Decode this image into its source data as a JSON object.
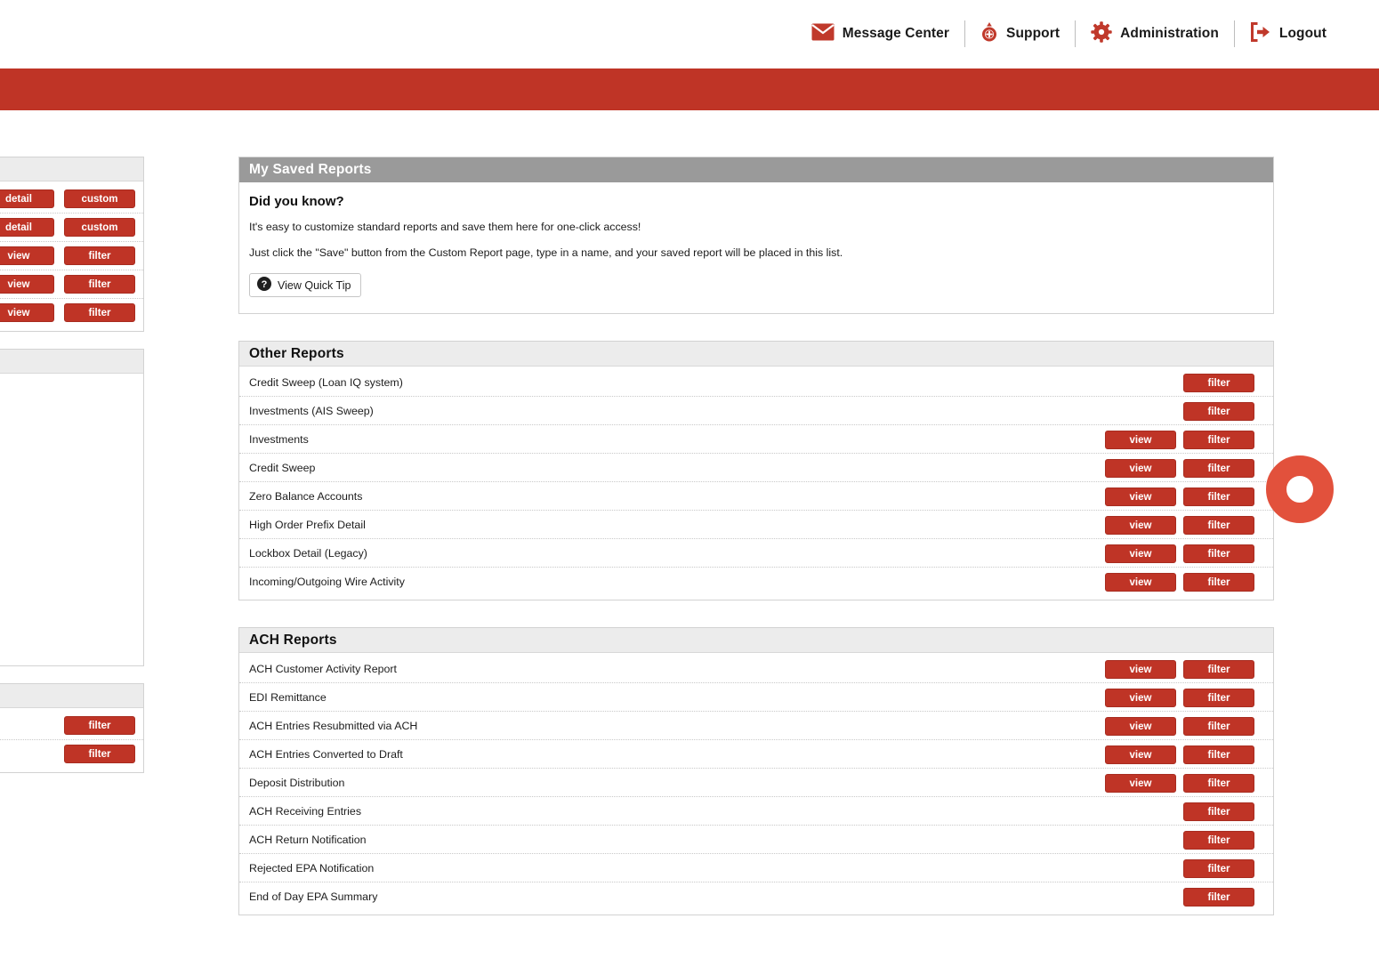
{
  "topbar": {
    "items": [
      {
        "label": "Message Center",
        "icon": "envelope-icon"
      },
      {
        "label": "Support",
        "icon": "support-icon"
      },
      {
        "label": "Administration",
        "icon": "gear-icon"
      },
      {
        "label": "Logout",
        "icon": "logout-icon"
      }
    ]
  },
  "colors": {
    "brand_red": "#bf3426",
    "ring_red": "#e2513c",
    "header_gray": "#9a9a9a",
    "header_light": "#ececec"
  },
  "saved_reports": {
    "title": "My Saved Reports",
    "did_you_know_title": "Did you know?",
    "line1": "It's easy to customize standard reports and save them here for one-click access!",
    "line2": "Just click the \"Save\" button from the Custom Report page, type in a name, and your saved report will be placed in this list.",
    "quick_tip_label": "View Quick Tip",
    "quick_tip_icon": "question-mark-icon"
  },
  "other_reports": {
    "title": "Other Reports",
    "rows": [
      {
        "label": "Credit Sweep (Loan IQ system)",
        "view": false,
        "filter": true
      },
      {
        "label": "Investments (AIS Sweep)",
        "view": false,
        "filter": true
      },
      {
        "label": "Investments",
        "view": true,
        "filter": true
      },
      {
        "label": "Credit Sweep",
        "view": true,
        "filter": true
      },
      {
        "label": "Zero Balance Accounts",
        "view": true,
        "filter": true
      },
      {
        "label": "High Order Prefix Detail",
        "view": true,
        "filter": true
      },
      {
        "label": "Lockbox Detail (Legacy)",
        "view": true,
        "filter": true
      },
      {
        "label": "Incoming/Outgoing Wire Activity",
        "view": true,
        "filter": true
      }
    ]
  },
  "ach_reports": {
    "title": "ACH Reports",
    "rows": [
      {
        "label": "ACH Customer Activity Report",
        "view": true,
        "filter": true
      },
      {
        "label": "EDI Remittance",
        "view": true,
        "filter": true
      },
      {
        "label": "ACH Entries Resubmitted via ACH",
        "view": true,
        "filter": true
      },
      {
        "label": "ACH Entries Converted to Draft",
        "view": true,
        "filter": true
      },
      {
        "label": "Deposit Distribution",
        "view": true,
        "filter": true
      },
      {
        "label": "ACH Receiving Entries",
        "view": false,
        "filter": true
      },
      {
        "label": "ACH Return Notification",
        "view": false,
        "filter": true
      },
      {
        "label": "Rejected EPA Notification",
        "view": false,
        "filter": true
      },
      {
        "label": "End of Day EPA Summary",
        "view": false,
        "filter": true
      }
    ]
  },
  "left_panel_top": {
    "rows": [
      {
        "a": "detail",
        "b": "custom"
      },
      {
        "a": "detail",
        "b": "custom"
      },
      {
        "a": "view",
        "b": "filter"
      },
      {
        "a": "view",
        "b": "filter"
      },
      {
        "a": "view",
        "b": "filter"
      }
    ]
  },
  "left_panel_bottom": {
    "rows": [
      {
        "b": "filter"
      },
      {
        "b": "filter"
      }
    ]
  },
  "buttons": {
    "view": "view",
    "filter": "filter",
    "detail": "detail",
    "custom": "custom"
  }
}
